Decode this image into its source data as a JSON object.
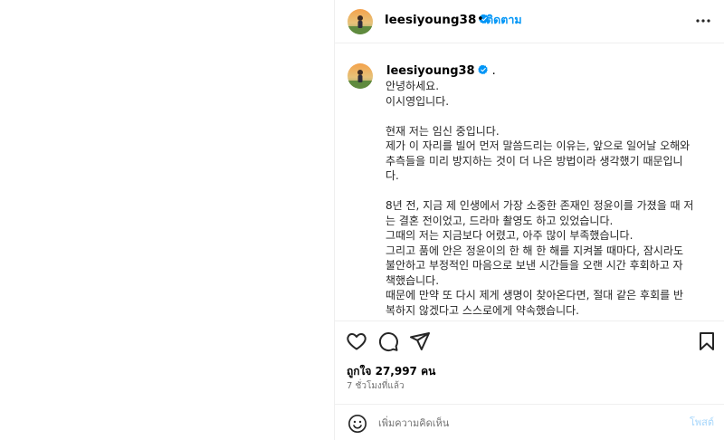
{
  "post": {
    "username": "leesiyoung38",
    "dot": "•",
    "follow_label": "ติดตาม",
    "caption_suffix": ".",
    "caption": "안녕하세요.\n이시영입니다.\n\n현재 저는 임신 중입니다.\n제가 이 자리를 빌어 먼저 말씀드리는 이유는, 앞으로 일어날 오해와\n추측들을 미리 방지하는 것이 더 나은 방법이라 생각했기 때문입니\n다.\n\n8년 전, 지금 제 인생에서 가장 소중한 존재인 정윤이를 가졌을 때 저\n는 결혼 전이었고, 드라마 촬영도 하고 있었습니다.\n그때의 저는 지금보다 어렸고, 아주 많이 부족했습니다.\n그리고 품에 안은 정윤이의 한 해 한 해를 지켜볼 때마다, 잠시라도\n불안하고 부정적인 마음으로 보낸 시간들을 오랜 시간 후회하고 자\n책했습니다.\n때문에 만약 또 다시 제게 생명이 찾아온다면, 절대 같은 후회를 반\n복하지 않겠다고 스스로에게 약속했습니다.",
    "likes": "ถูกใจ 27,997 คน",
    "time_ago": "7 ชั่วโมงที่แล้ว"
  },
  "comment": {
    "placeholder": "เพิ่มความคิดเห็น",
    "post_label": "โพสต์"
  },
  "icons": {
    "verified": "verified-badge-icon",
    "more": "more-options-icon",
    "like": "heart-icon",
    "comment": "comment-bubble-icon",
    "share": "paper-plane-icon",
    "save": "bookmark-icon",
    "emoji": "emoji-smiley-icon"
  },
  "colors": {
    "accent": "#0095f6",
    "post_disabled": "#a6d6fb",
    "verified": "#0095f6",
    "muted": "#737373"
  }
}
